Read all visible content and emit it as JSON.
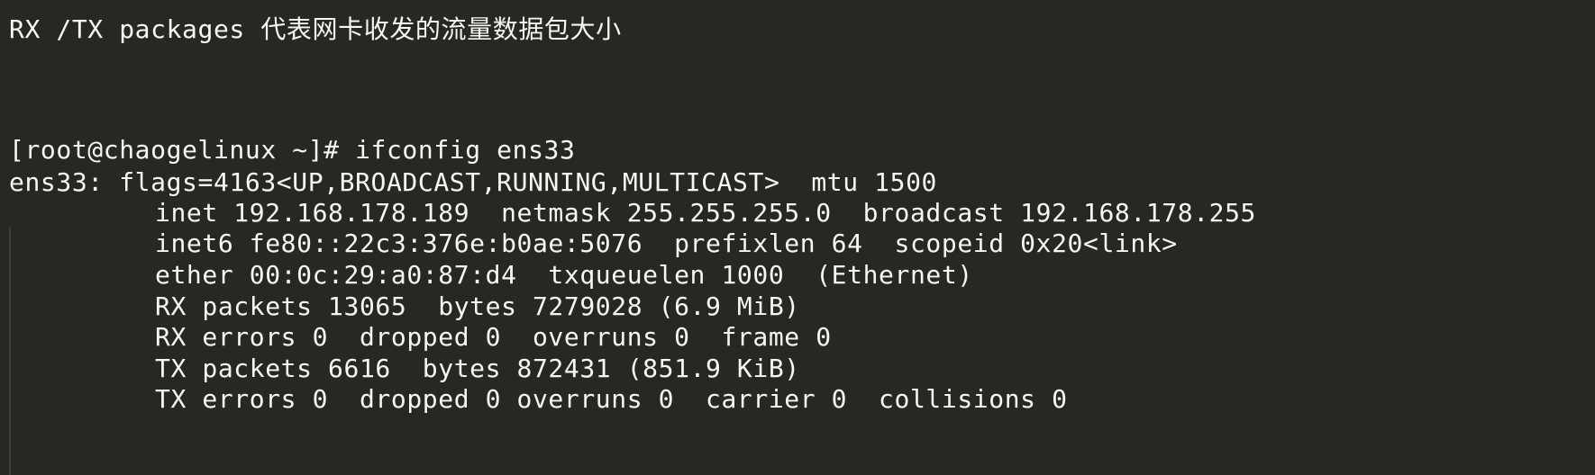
{
  "note_line": "RX /TX packages 代表网卡收发的流量数据包大小",
  "prompt_line": "[root@chaogelinux ~]# ifconfig ens33",
  "output": {
    "header": "ens33: flags=4163<UP,BROADCAST,RUNNING,MULTICAST>  mtu 1500",
    "lines": [
      "inet 192.168.178.189  netmask 255.255.255.0  broadcast 192.168.178.255",
      "inet6 fe80::22c3:376e:b0ae:5076  prefixlen 64  scopeid 0x20<link>",
      "ether 00:0c:29:a0:87:d4  txqueuelen 1000  (Ethernet)",
      "RX packets 13065  bytes 7279028 (6.9 MiB)",
      "RX errors 0  dropped 0  overruns 0  frame 0",
      "TX packets 6616  bytes 872431 (851.9 KiB)",
      "TX errors 0  dropped 0 overruns 0  carrier 0  collisions 0"
    ]
  },
  "colors": {
    "background": "#272822",
    "text": "#f8f8f2"
  }
}
